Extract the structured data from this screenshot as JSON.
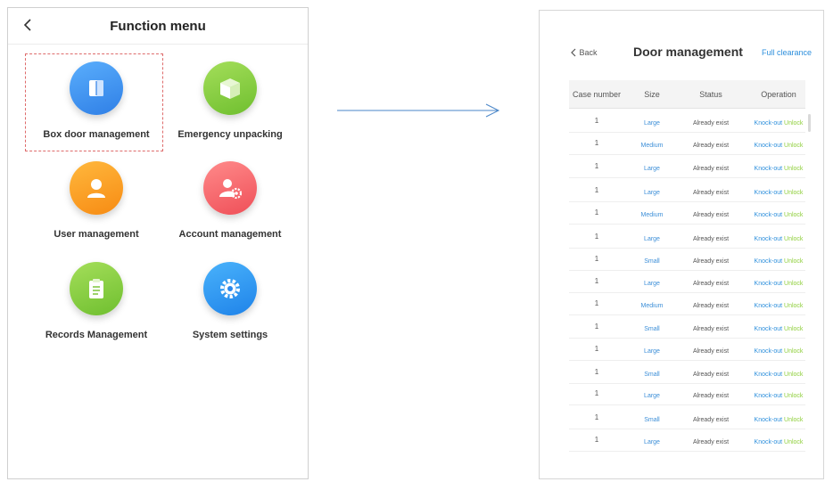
{
  "left_screen": {
    "title": "Function menu",
    "items": [
      {
        "label": "Box door management",
        "icon": "door-icon",
        "color": "#3b8ff0"
      },
      {
        "label": "Emergency unpacking",
        "icon": "box-icon",
        "color": "#86cc3f"
      },
      {
        "label": "User management",
        "icon": "user-icon",
        "color": "#f8a126"
      },
      {
        "label": "Account management",
        "icon": "user-gear-icon",
        "color": "#f5636c"
      },
      {
        "label": "Records Management",
        "icon": "clipboard-icon",
        "color": "#86cc3f"
      },
      {
        "label": "System settings",
        "icon": "gear-icon",
        "color": "#2b8cf0"
      }
    ],
    "highlighted_item": "Box door management"
  },
  "right_screen": {
    "back_label": "Back",
    "title": "Door management",
    "action_label": "Full clearance",
    "columns": [
      "Case number",
      "Size",
      "Status",
      "Operation"
    ],
    "rows": [
      {
        "case": "1",
        "size": "Large",
        "status": "Already exist",
        "op1": "Knock-out",
        "op2": "Unlock"
      },
      {
        "case": "1",
        "size": "Medium",
        "status": "Already exist",
        "op1": "Knock-out",
        "op2": "Unlock"
      },
      {
        "case": "1",
        "size": "Large",
        "status": "Already exist",
        "op1": "Knock-out",
        "op2": "Unlock"
      },
      {
        "case": "1",
        "size": "Large",
        "status": "Already exist",
        "op1": "Knock-out",
        "op2": "Unlock"
      },
      {
        "case": "1",
        "size": "Medium",
        "status": "Already exist",
        "op1": "Knock-out",
        "op2": "Unlock"
      },
      {
        "case": "1",
        "size": "Large",
        "status": "Already exist",
        "op1": "Knock-out",
        "op2": "Unlock"
      },
      {
        "case": "1",
        "size": "Small",
        "status": "Already exist",
        "op1": "Knock-out",
        "op2": "Unlock"
      },
      {
        "case": "1",
        "size": "Large",
        "status": "Already exist",
        "op1": "Knock-out",
        "op2": "Unlock"
      },
      {
        "case": "1",
        "size": "Medium",
        "status": "Already exist",
        "op1": "Knock-out",
        "op2": "Unlock"
      },
      {
        "case": "1",
        "size": "Small",
        "status": "Already exist",
        "op1": "Knock-out",
        "op2": "Unlock"
      },
      {
        "case": "1",
        "size": "Large",
        "status": "Already exist",
        "op1": "Knock-out",
        "op2": "Unlock"
      },
      {
        "case": "1",
        "size": "Small",
        "status": "Already exist",
        "op1": "Knock-out",
        "op2": "Unlock"
      },
      {
        "case": "1",
        "size": "Large",
        "status": "Already exist",
        "op1": "Knock-out",
        "op2": "Unlock"
      },
      {
        "case": "1",
        "size": "Small",
        "status": "Already exist",
        "op1": "Knock-out",
        "op2": "Unlock"
      },
      {
        "case": "1",
        "size": "Large",
        "status": "Already exist",
        "op1": "Knock-out",
        "op2": "Unlock"
      }
    ],
    "colors": {
      "link": "#2d8fdc",
      "unlock": "#8fcf3c"
    }
  }
}
